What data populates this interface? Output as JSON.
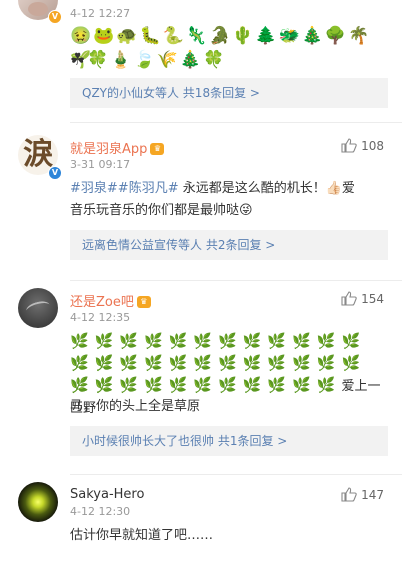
{
  "comment0": {
    "time": "4-12 12:27",
    "emoji_row1": "🤢🐸🐢🐛🐍🦎🐊🌵🌲🐲🎄🌳🌴🌱",
    "emoji_row2": "☘🍀🎍🍃🌾🎄🍀",
    "reply_summary": "QZY的小仙女等人  共18条回复 >"
  },
  "comment1": {
    "avatar_text": "淚",
    "username": "就是羽泉App",
    "time": "3-31 09:17",
    "likes": "108",
    "tag1": "#羽泉#",
    "tag2": "#陈羽凡#",
    "text1": " 永远都是这么酷的机长！",
    "text1_emoji": "👍🏻",
    "text1_tail": "爱",
    "text2": "音乐玩音乐的你们都是最帅哒",
    "text2_emoji": "😜",
    "reply_summary": "远离色情公益宣传等人  共2条回复 >"
  },
  "comment2": {
    "username": "还是Zoe吧",
    "time": "4-12 12:35",
    "likes": "154",
    "fern_row1": "🌿🌿🌿🌿🌿🌿🌿🌿🌿🌿🌿🌿🌿🌿",
    "fern_row2": "🌿🌿🌿🌿🌿🌿🌿🌿🌿🌿🌿🌿🌿🌿",
    "fern_row3": "🌿🌿🌿🌿🌿🌿🌿🌿🌿🌿🌿",
    "text_tail": "爱上一匹野",
    "text2": "马，你的头上全是草原",
    "reply_summary": "小时候很帅长大了也很帅  共1条回复 >"
  },
  "comment3": {
    "username": "Sakya-Hero",
    "time": "4-12 12:30",
    "likes": "147",
    "text": "估计你早就知道了吧……"
  },
  "colors": {
    "username": "#eb7350",
    "link": "#5b80b2",
    "reply_bg": "#f2f2f2"
  }
}
